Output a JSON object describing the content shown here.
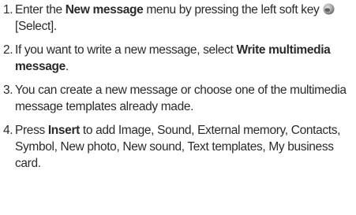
{
  "steps": [
    {
      "number": "1.",
      "before": "Enter the ",
      "bold": "New message",
      "after": " menu by pressing the left soft key",
      "icon": "left-soft-key-icon",
      "tail": "[Select]."
    },
    {
      "number": "2.",
      "before": "If you want to write a new message, select ",
      "bold": "Write multimedia message",
      "after": "."
    },
    {
      "number": "3.",
      "text": "You can create a new message or choose one of the multimedia message templates already made."
    },
    {
      "number": "4.",
      "before": "Press ",
      "bold": "Insert",
      "after": " to add Image, Sound, External memory, Contacts, Symbol, New photo, New sound, Text templates, My business card."
    }
  ],
  "colors": {
    "text": "#2a2a2a",
    "icon_fill": "#9a9a9a"
  }
}
